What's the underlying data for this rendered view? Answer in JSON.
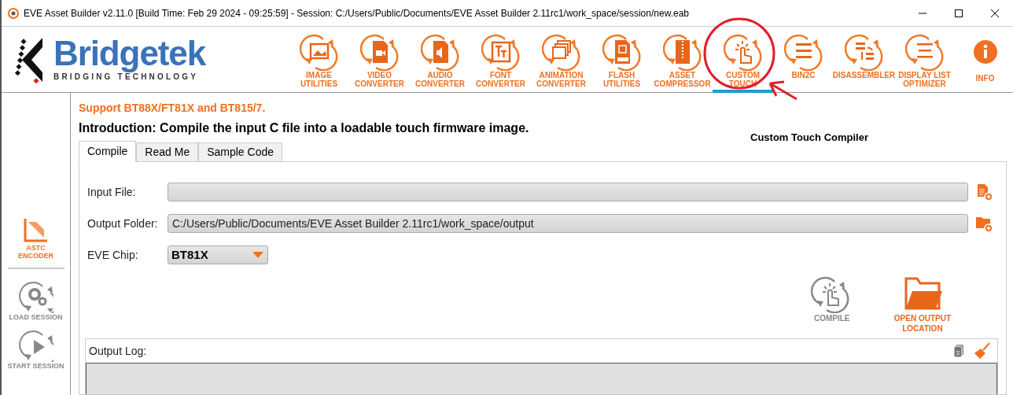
{
  "window": {
    "title": "EVE Asset Builder v2.11.0 [Build Time: Feb 29 2024 - 09:25:59] - Session: C:/Users/Public/Documents/EVE Asset Builder 2.11rc1/work_space/session/new.eab"
  },
  "logo": {
    "name": "Bridgetek",
    "tagline": "BRIDGING TECHNOLOGY"
  },
  "toolbar": [
    {
      "kind": "image",
      "label": "IMAGE\nUTILITIES",
      "selected": false
    },
    {
      "kind": "video",
      "label": "VIDEO\nCONVERTER",
      "selected": false
    },
    {
      "kind": "audio",
      "label": "AUDIO\nCONVERTER",
      "selected": false
    },
    {
      "kind": "font",
      "label": "FONT\nCONVERTER",
      "selected": false
    },
    {
      "kind": "animation",
      "label": "ANIMATION\nCONVERTER",
      "selected": false
    },
    {
      "kind": "flash",
      "label": "FLASH\nUTILITIES",
      "selected": false
    },
    {
      "kind": "asset",
      "label": "ASSET\nCOMPRESSOR",
      "selected": false
    },
    {
      "kind": "touch",
      "label": "CUSTOM\nTOUCH",
      "selected": true
    },
    {
      "kind": "binary",
      "label": "BIN2C",
      "selected": false
    },
    {
      "kind": "disasm",
      "label": "DISASSEMBLER",
      "selected": false
    },
    {
      "kind": "dlo",
      "label": "DISPLAY LIST\nOPTIMIZER",
      "selected": false
    },
    {
      "kind": "info",
      "label": "INFO",
      "selected": false
    }
  ],
  "sidebar": [
    {
      "kind": "astc",
      "label": "ASTC\nENCODER",
      "disabled": false
    },
    {
      "kind": "load",
      "label": "LOAD SESSION",
      "disabled": true
    },
    {
      "kind": "start",
      "label": "START SESSION",
      "disabled": true
    }
  ],
  "support_note": "Support BT88X/FT81X and BT815/7.",
  "introduction": "Introduction: Compile the input C file into a loadable touch firmware image.",
  "tabs": [
    {
      "label": "Compile",
      "selected": true
    },
    {
      "label": "Read Me",
      "selected": false
    },
    {
      "label": "Sample Code",
      "selected": false
    }
  ],
  "fields": [
    {
      "kind": "file",
      "label": "Input File:"
    },
    {
      "kind": "folder",
      "label": "Output Folder:",
      "value": "C:/Users/Public/Documents/EVE Asset Builder 2.11rc1/work_space/output"
    }
  ],
  "eve_chip": {
    "label": "EVE Chip:",
    "value": "BT81X"
  },
  "actions": [
    {
      "kind": "compile",
      "label": "COMPILE",
      "disabled": true
    },
    {
      "kind": "open",
      "label": "OPEN OUTPUT\nLOCATION",
      "disabled": false
    }
  ],
  "output_log": {
    "label": "Output Log:"
  },
  "annotation": {
    "text": "Custom Touch Compiler"
  }
}
